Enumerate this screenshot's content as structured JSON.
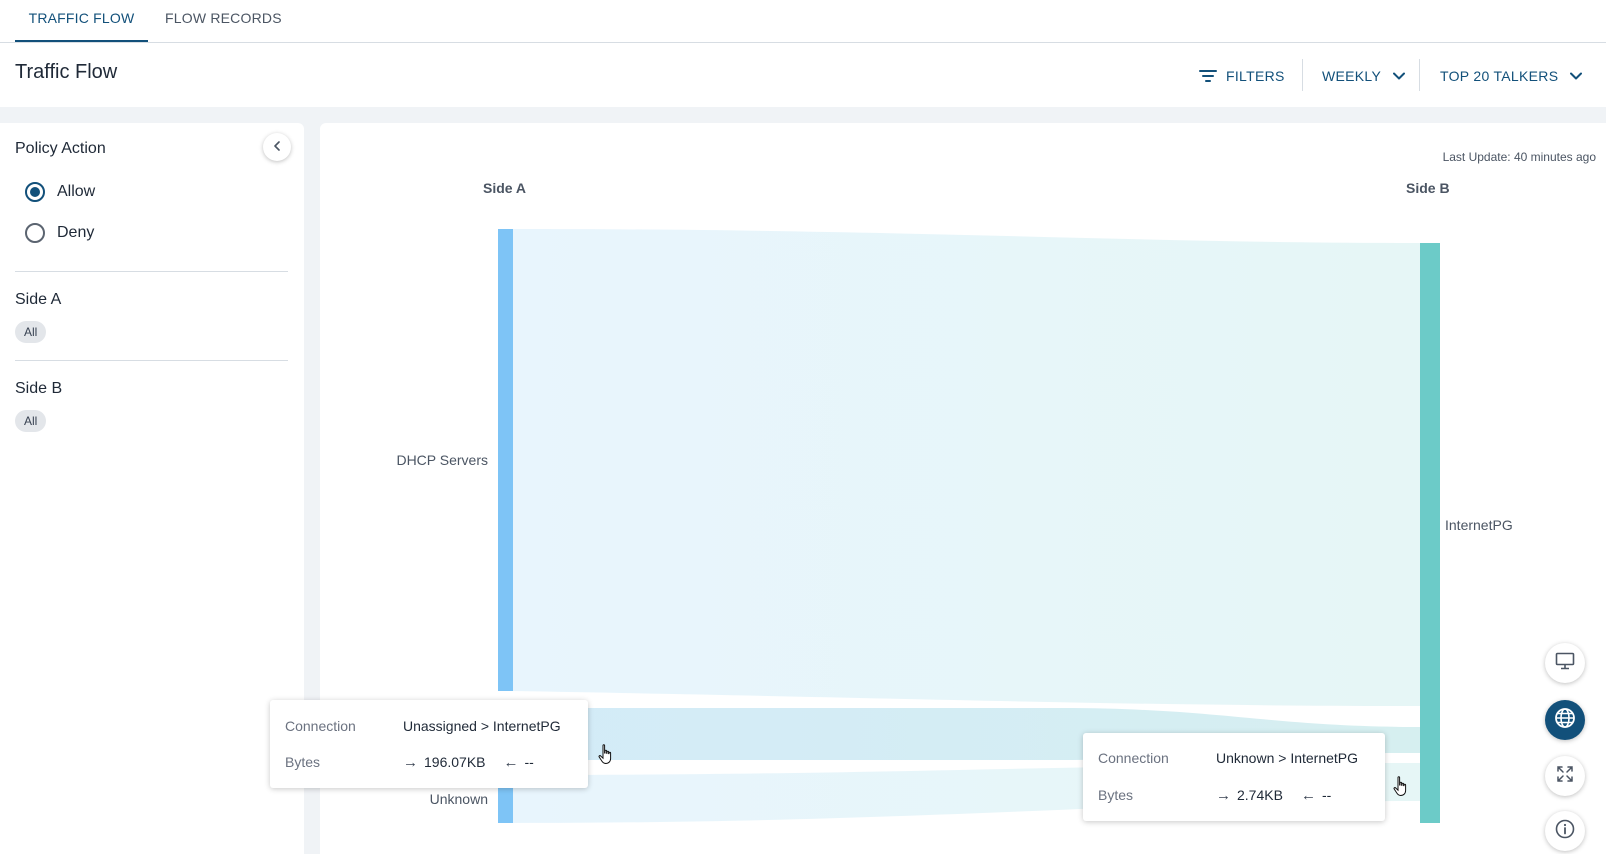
{
  "tabs": [
    {
      "label": "TRAFFIC FLOW",
      "active": true
    },
    {
      "label": "FLOW RECORDS",
      "active": false
    }
  ],
  "header": {
    "title": "Traffic Flow",
    "filters_label": "FILTERS",
    "period_label": "WEEKLY",
    "talkers_label": "TOP 20 TALKERS"
  },
  "side_panel": {
    "policy_action": {
      "title": "Policy Action",
      "options": [
        {
          "label": "Allow",
          "selected": true
        },
        {
          "label": "Deny",
          "selected": false
        }
      ]
    },
    "side_a": {
      "title": "Side A",
      "chip": "All"
    },
    "side_b": {
      "title": "Side B",
      "chip": "All"
    }
  },
  "main": {
    "last_update": "Last Update: 40 minutes ago"
  },
  "chart_data": {
    "type": "sankey",
    "left_axis_label": "Side A",
    "right_axis_label": "Side B",
    "left_nodes": [
      "DHCP Servers",
      "Unassigned",
      "Unknown"
    ],
    "right_nodes": [
      "InternetPG"
    ],
    "links": [
      {
        "source": "DHCP Servers",
        "target": "InternetPG",
        "bytes_forward": null,
        "bytes_reverse": null
      },
      {
        "source": "Unassigned",
        "target": "InternetPG",
        "bytes_forward": "196.07KB",
        "bytes_reverse": "--"
      },
      {
        "source": "Unknown",
        "target": "InternetPG",
        "bytes_forward": "2.74KB",
        "bytes_reverse": "--"
      }
    ],
    "colors": {
      "left_node": "#7ec4f6",
      "right_node": "#6ccbc8",
      "link": "#e6f4fb",
      "link_highlight": "#d2ebf6"
    }
  },
  "tooltips": [
    {
      "connection_key": "Connection",
      "connection_value": "Unassigned > InternetPG",
      "bytes_key": "Bytes",
      "forward": "196.07KB",
      "reverse": "--"
    },
    {
      "connection_key": "Connection",
      "connection_value": "Unknown > InternetPG",
      "bytes_key": "Bytes",
      "forward": "2.74KB",
      "reverse": "--"
    }
  ],
  "fabs": [
    {
      "icon": "monitor-icon",
      "active": false
    },
    {
      "icon": "globe-icon",
      "active": true
    },
    {
      "icon": "expand-icon",
      "active": false
    },
    {
      "icon": "info-icon",
      "active": false
    }
  ],
  "icons": {
    "arrow_forward": "→",
    "arrow_back": "←"
  }
}
